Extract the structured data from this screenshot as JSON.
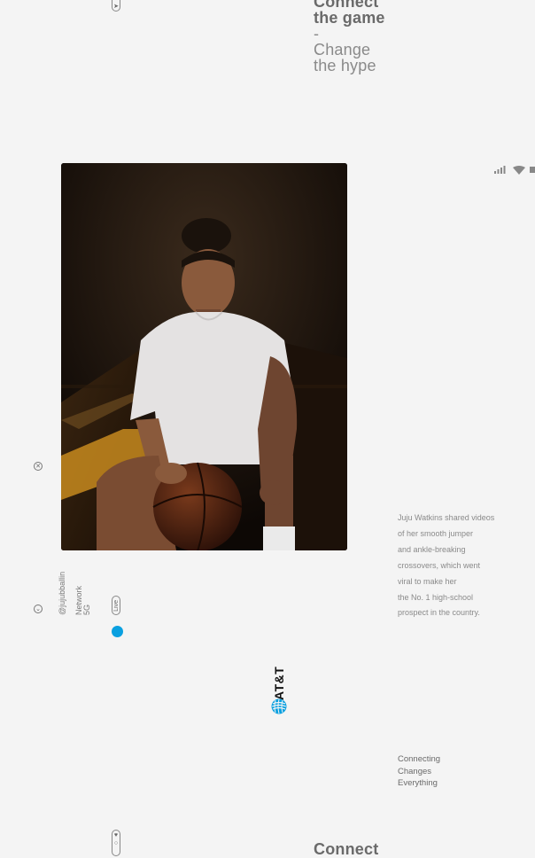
{
  "headline_top": {
    "line1": "Connect",
    "line2": "the game",
    "dash": "-",
    "line3": "Change",
    "line4": "the hype"
  },
  "headline_bottom": {
    "line1": "Connect"
  },
  "status_icons": [
    "signal-icon",
    "wifi-icon",
    "battery-icon"
  ],
  "social": {
    "handle": "@jujubballin",
    "network_label": "Network",
    "network_value": "5G",
    "live_label": "Live"
  },
  "description": {
    "lines": [
      "Juju Watkins shared videos",
      "of her smooth jumper",
      "and ankle-breaking",
      "crossovers, which went",
      "viral to make her",
      "the No. 1 high-school",
      "prospect in the country."
    ]
  },
  "brand": {
    "name": "AT&T",
    "color": "#0aa0e0"
  },
  "tagline": {
    "lines": [
      "Connecting",
      "Changes",
      "Everything"
    ]
  }
}
